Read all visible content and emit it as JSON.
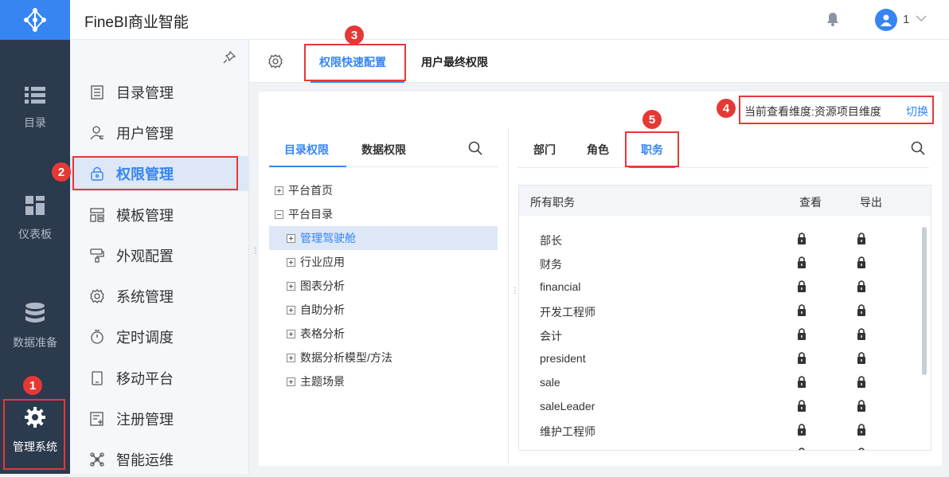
{
  "app": {
    "title": "FineBI商业智能",
    "accent": "#3685f2"
  },
  "user": {
    "name": "1"
  },
  "rail": {
    "items": [
      {
        "label": "目录",
        "icon": "list-icon"
      },
      {
        "label": "仪表板",
        "icon": "dashboard-icon"
      },
      {
        "label": "数据准备",
        "icon": "database-icon"
      },
      {
        "label": "管理系统",
        "icon": "gear-icon",
        "active": true
      }
    ]
  },
  "menu": {
    "items": [
      {
        "label": "目录管理",
        "icon": "catalog-icon"
      },
      {
        "label": "用户管理",
        "icon": "user-icon"
      },
      {
        "label": "权限管理",
        "icon": "lock-icon",
        "active": true
      },
      {
        "label": "模板管理",
        "icon": "template-icon"
      },
      {
        "label": "外观配置",
        "icon": "paint-icon"
      },
      {
        "label": "系统管理",
        "icon": "gear-icon"
      },
      {
        "label": "定时调度",
        "icon": "timer-icon"
      },
      {
        "label": "移动平台",
        "icon": "mobile-icon"
      },
      {
        "label": "注册管理",
        "icon": "register-icon"
      },
      {
        "label": "智能运维",
        "icon": "ops-icon"
      }
    ]
  },
  "tabs": {
    "items": [
      {
        "label": "权限快速配置",
        "active": true
      },
      {
        "label": "用户最终权限"
      }
    ]
  },
  "dimension": {
    "text": "当前查看维度:资源项目维度",
    "switch": "切换"
  },
  "left_panel": {
    "tabs": [
      {
        "label": "目录权限",
        "active": true
      },
      {
        "label": "数据权限"
      }
    ],
    "tree": [
      {
        "label": "平台首页",
        "state": "plus",
        "level": 0
      },
      {
        "label": "平台目录",
        "state": "minus",
        "level": 0
      },
      {
        "label": "管理驾驶舱",
        "state": "plus",
        "level": 1,
        "selected": true
      },
      {
        "label": "行业应用",
        "state": "plus",
        "level": 1
      },
      {
        "label": "图表分析",
        "state": "plus",
        "level": 1
      },
      {
        "label": "自助分析",
        "state": "plus",
        "level": 1
      },
      {
        "label": "表格分析",
        "state": "plus",
        "level": 1
      },
      {
        "label": "数据分析模型/方法",
        "state": "plus",
        "level": 1
      },
      {
        "label": "主题场景",
        "state": "plus",
        "level": 1
      }
    ]
  },
  "right_panel": {
    "tabs": [
      {
        "label": "部门"
      },
      {
        "label": "角色"
      },
      {
        "label": "职务",
        "active": true
      }
    ],
    "columns": {
      "name": "所有职务",
      "view": "查看",
      "export": "导出"
    },
    "rows": [
      "部长",
      "财务",
      "financial",
      "开发工程师",
      "会计",
      "president",
      "sale",
      "saleLeader",
      "维护工程师"
    ]
  },
  "annotations": [
    "1",
    "2",
    "3",
    "4",
    "5"
  ],
  "colors": {
    "annotation": "#e53935",
    "rail": "#2c3a4e",
    "selected_bg": "#dde7f8"
  }
}
